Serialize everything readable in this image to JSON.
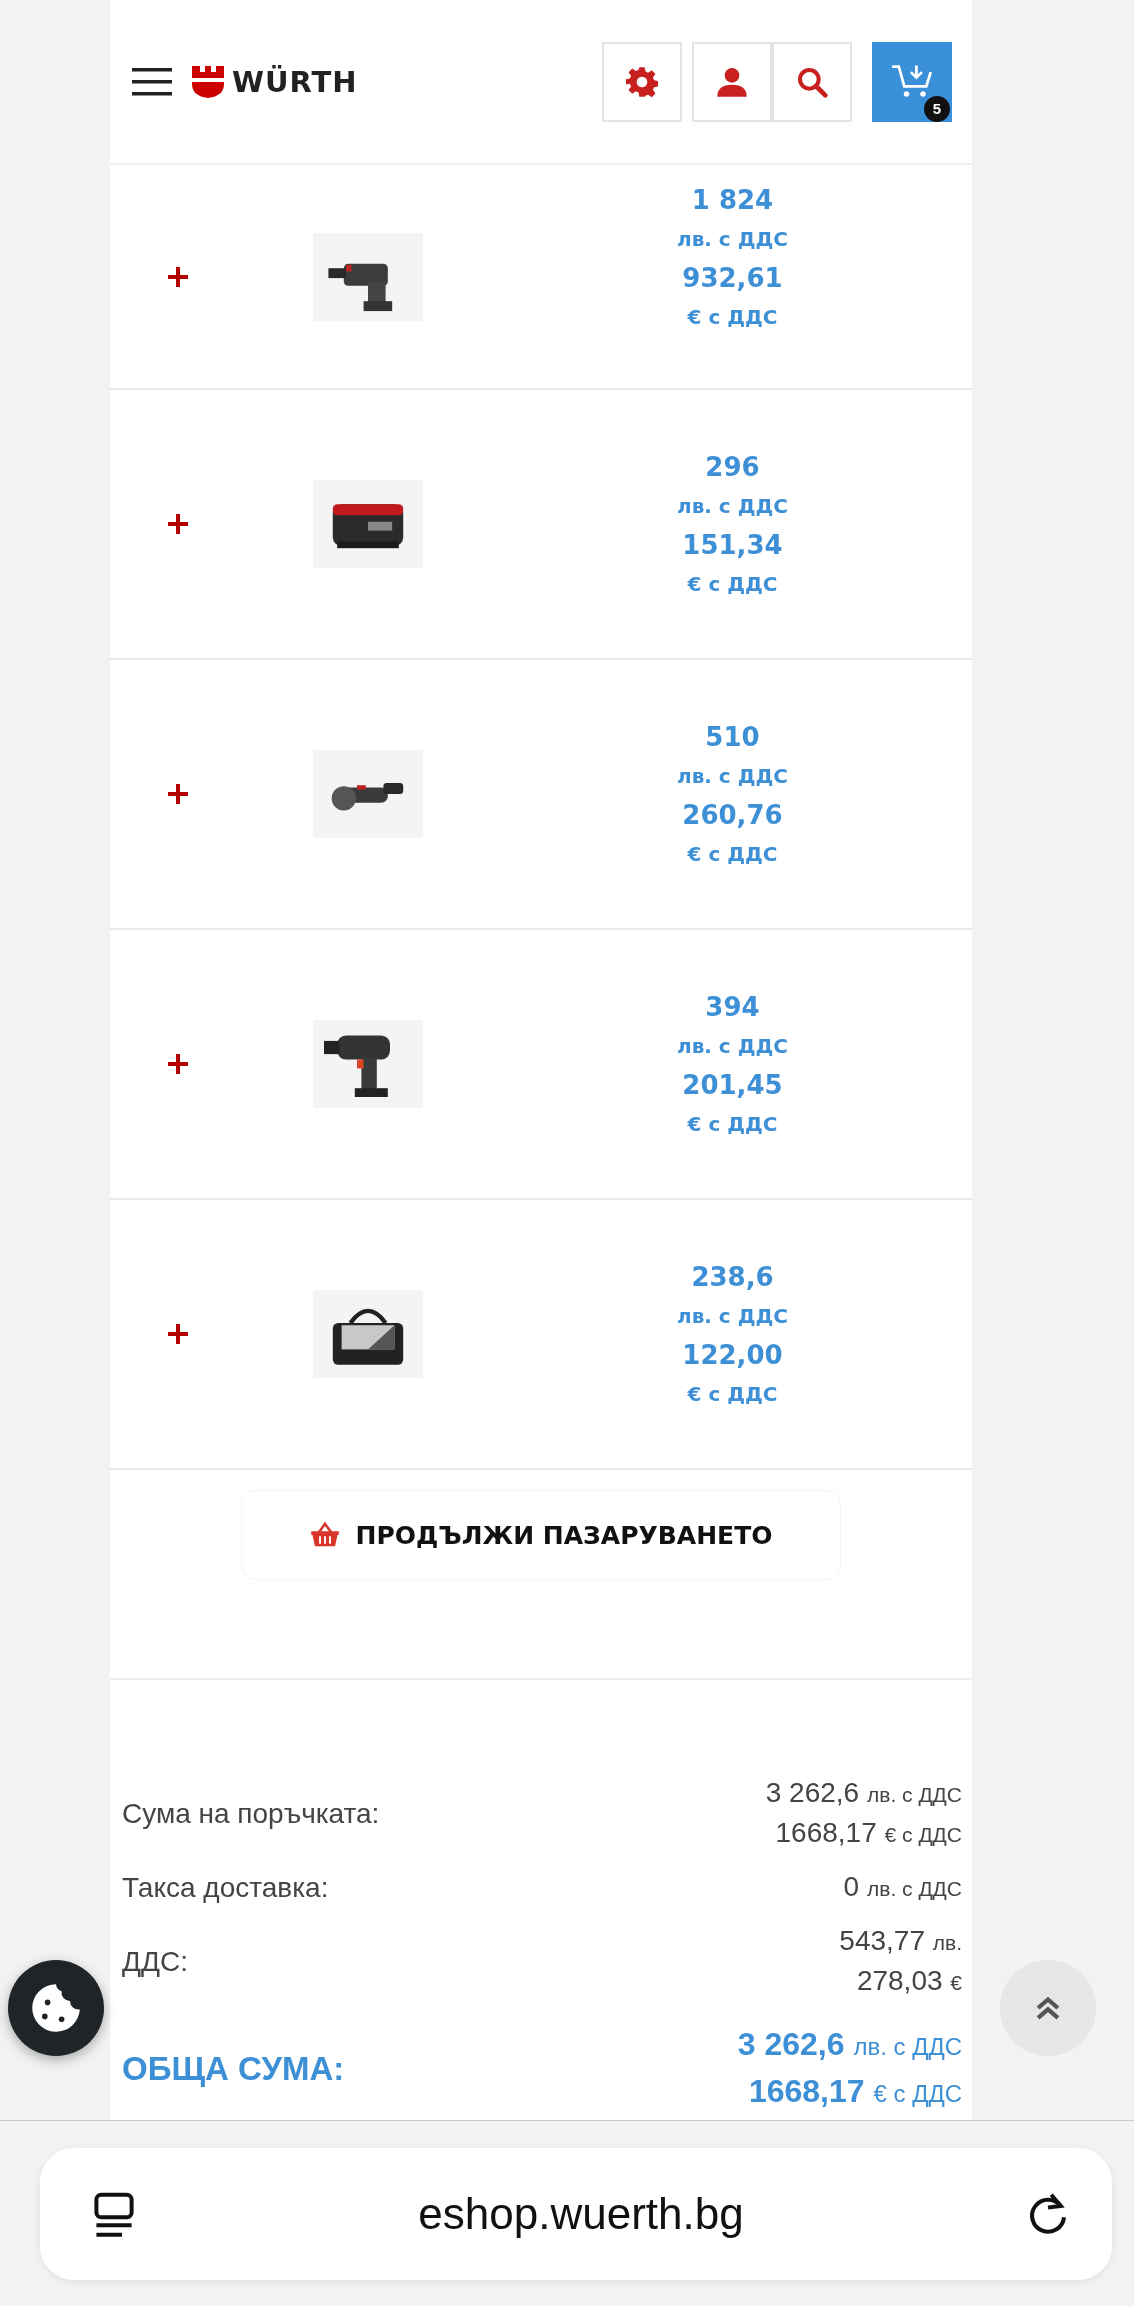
{
  "header": {
    "logo": "WÜRTH",
    "cart_count": "5"
  },
  "products": [
    {
      "price_bgn": "1 824",
      "bgn_label": "лв. с ДДС",
      "price_eur": "932,61",
      "eur_label": "€ с ДДС"
    },
    {
      "price_bgn": "296",
      "bgn_label": "лв. с ДДС",
      "price_eur": "151,34",
      "eur_label": "€ с ДДС"
    },
    {
      "price_bgn": "510",
      "bgn_label": "лв. с ДДС",
      "price_eur": "260,76",
      "eur_label": "€ с ДДС"
    },
    {
      "price_bgn": "394",
      "bgn_label": "лв. с ДДС",
      "price_eur": "201,45",
      "eur_label": "€ с ДДС"
    },
    {
      "price_bgn": "238,6",
      "bgn_label": "лв. с ДДС",
      "price_eur": "122,00",
      "eur_label": "€ с ДДС"
    }
  ],
  "continue_button": "ПРОДЪЛЖИ ПАЗАРУВАНЕТО",
  "summary": [
    {
      "label": "Сума на поръчката:",
      "lines": [
        {
          "amount": "3 262,6",
          "unit": "лв. с ДДС"
        },
        {
          "amount": "1668,17",
          "unit": "€ с ДДС"
        }
      ]
    },
    {
      "label": "Такса доставка:",
      "lines": [
        {
          "amount": "0",
          "unit": "лв. с ДДС"
        }
      ]
    },
    {
      "label": "ДДС:",
      "lines": [
        {
          "amount": "543,77",
          "unit": "лв."
        },
        {
          "amount": "278,03",
          "unit": "€"
        }
      ]
    }
  ],
  "total": {
    "label": "ОБЩА СУМА:",
    "lines": [
      {
        "amount": "3 262,6",
        "unit": "лв. с ДДС"
      },
      {
        "amount": "1668,17",
        "unit": "€ с ДДС"
      }
    ]
  },
  "browser": {
    "url": "eshop.wuerth.bg"
  }
}
